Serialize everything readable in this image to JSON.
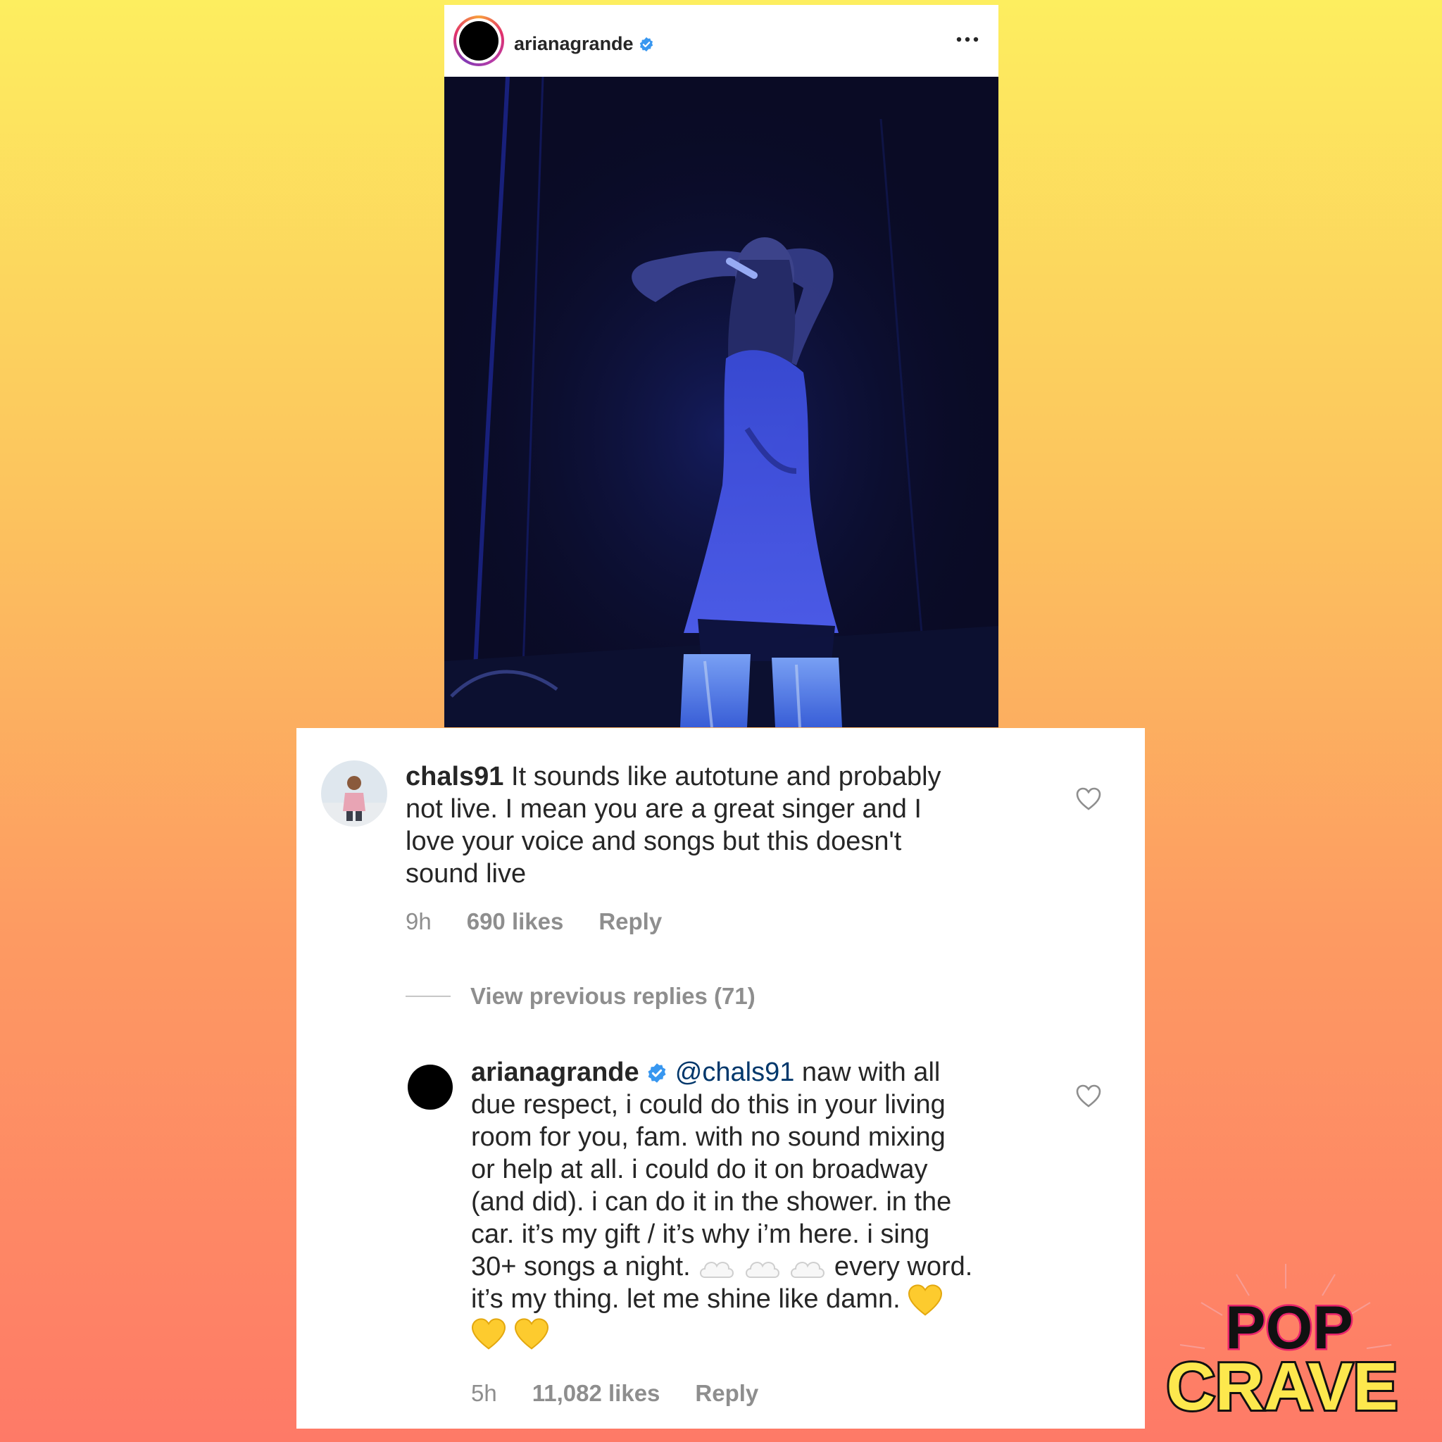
{
  "post": {
    "username": "arianagrande",
    "verified_icon": "verified-badge-icon",
    "more_icon": "more-options-icon"
  },
  "comments": [
    {
      "username": "chals91",
      "text_lines": [
        "It sounds like autotune and probably",
        "not live. I mean you are a great singer and I",
        "love your voice and songs but this doesn't",
        "sound live"
      ],
      "time": "9h",
      "likes": "690 likes",
      "reply_label": "Reply"
    },
    {
      "username": "arianagrande",
      "mention": "@chals91",
      "text_first": "naw with all",
      "text_lines": [
        "due respect, i could do this in your living",
        "room for you, fam. with no sound mixing",
        "or help at all. i could do it on broadway",
        "(and did). i can do it in the shower. in the",
        "car. it’s my gift / it’s why i’m here. i sing"
      ],
      "line_before_clouds": "30+ songs a night.",
      "line_after_clouds": "every word.",
      "last_line": "it’s my thing. let me shine like damn.",
      "time": "5h",
      "likes": "11,082 likes",
      "reply_label": "Reply"
    }
  ],
  "view_previous": "View previous replies (71)",
  "logo": {
    "line1": "POP",
    "line2": "CRAVE"
  },
  "colors": {
    "verified": "#3897f0",
    "mention": "#00376b",
    "meta": "#8e8e8e",
    "logo_yellow": "#fde84d",
    "logo_pink": "#e8236b"
  }
}
